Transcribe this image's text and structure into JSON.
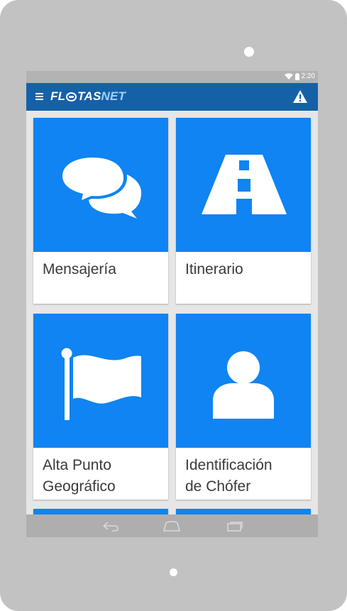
{
  "statusbar": {
    "time": "2:20"
  },
  "appbar": {
    "logo_left": "FL",
    "logo_mid": "TAS",
    "logo_right": "NET"
  },
  "tiles": [
    {
      "label": "Mensajería",
      "icon": "chat-bubbles-icon"
    },
    {
      "label": "Itinerario",
      "icon": "road-icon"
    },
    {
      "label_line1": "Alta Punto",
      "label_line2": "Geográfico",
      "icon": "flag-icon"
    },
    {
      "label_line1": "Identificación",
      "label_line2": "de Chófer",
      "icon": "driver-person-icon"
    }
  ],
  "colors": {
    "tile": "#0f84f2",
    "appbar": "#1561a8",
    "device": "#c2c2c2"
  }
}
